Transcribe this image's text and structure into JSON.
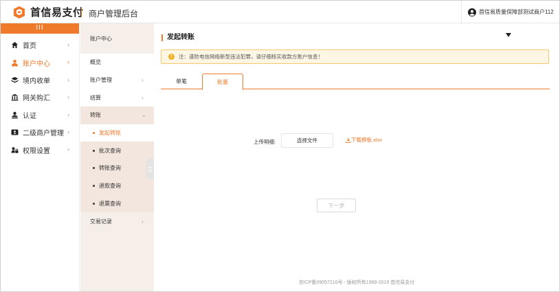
{
  "header": {
    "brand": "首信易支付",
    "title": "商户管理后台",
    "user": "首信易质量保障部测试商户112"
  },
  "nav": {
    "collapse": "III",
    "items": [
      {
        "label": "首页",
        "icon": "home-icon"
      },
      {
        "label": "账户中心",
        "icon": "user-icon",
        "active": true
      },
      {
        "label": "境内收单",
        "icon": "layers-icon"
      },
      {
        "label": "网关购汇",
        "icon": "bank-icon"
      },
      {
        "label": "认证",
        "icon": "person-id-icon"
      },
      {
        "label": "二级商户管理",
        "icon": "id-card-icon"
      },
      {
        "label": "权限设置",
        "icon": "lock-user-icon"
      }
    ]
  },
  "subnav": {
    "head": "账户中心",
    "items": {
      "overview": "概览",
      "account_mgmt": "账户管理",
      "settlement": "结算",
      "transfer": "转账",
      "transfer_sub": [
        "发起转账",
        "批次查询",
        "转账查询",
        "退款查询",
        "退票查询"
      ],
      "trade_records": "交易记录"
    }
  },
  "main": {
    "title": "发起转账",
    "notice": "注：谨防电信网络新型违法犯罪，请仔细核实收款方账户信息！",
    "tabs": [
      "单笔",
      "批量"
    ],
    "active_tab": "批量",
    "upload_label": "上传明细:",
    "choose_file": "选择文件",
    "download_template": "下载模板.xlsx",
    "next": "下一步"
  },
  "footer": "京ICP备09057216号 - 版权所有1999-2019 首信易支付",
  "colors": {
    "accent": "#ef7a2c",
    "warn": "#f4b223"
  }
}
